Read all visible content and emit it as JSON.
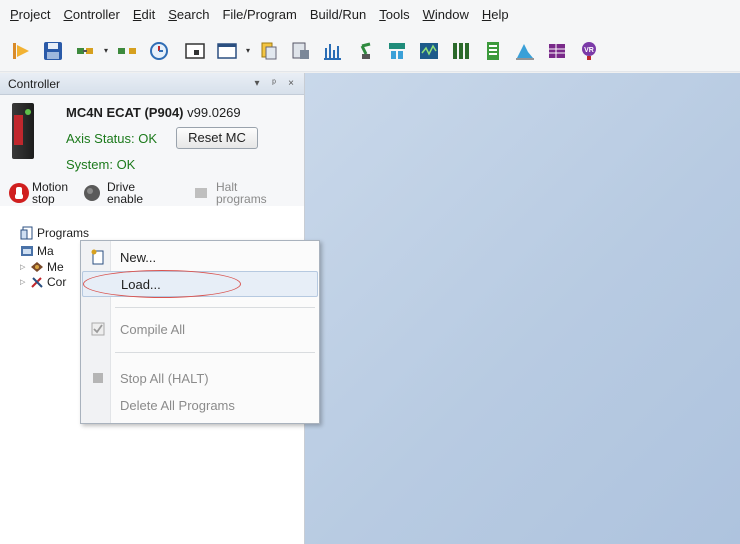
{
  "menubar": {
    "items": [
      {
        "label": "Project",
        "key": "P"
      },
      {
        "label": "Controller",
        "key": "C"
      },
      {
        "label": "Edit",
        "key": "E"
      },
      {
        "label": "Search",
        "key": "S"
      },
      {
        "label": "File/Program",
        "key": ""
      },
      {
        "label": "Build/Run",
        "key": ""
      },
      {
        "label": "Tools",
        "key": "T"
      },
      {
        "label": "Window",
        "key": "W"
      },
      {
        "label": "Help",
        "key": "H"
      }
    ]
  },
  "toolbar": {
    "icons": [
      "build-icon",
      "save-icon",
      "connect-icon",
      "disconnect-icon",
      "clock-icon",
      "terminal-icon",
      "window-icon",
      "program-icon",
      "variables-icon",
      "scope-icon",
      "robot-icon",
      "network-icon",
      "oscilloscope-icon",
      "io-icon",
      "table-icon",
      "graph-icon",
      "grid-icon",
      "vr-icon"
    ]
  },
  "panel": {
    "title": "Controller",
    "header_buttons": [
      "▾",
      "ᵖ",
      "×"
    ],
    "device_name": "MC4N ECAT (P904)",
    "device_version": "v99.0269",
    "axis_status": "Axis Status: OK",
    "reset_label": "Reset MC",
    "system_status": "System: OK",
    "motion_stop_line1": "Motion",
    "motion_stop_line2": "stop",
    "drive_enable_line1": "Drive",
    "drive_enable_line2": "enable",
    "halt_line1": "Halt",
    "halt_line2": "programs",
    "colors": {
      "status_ok": "#1c7a1c",
      "stop_red": "#d01f1f"
    }
  },
  "tree": {
    "items": [
      {
        "label": "Programs"
      },
      {
        "label": "Ma"
      },
      {
        "label": "Me"
      },
      {
        "label": "Cor"
      }
    ]
  },
  "context_menu": {
    "new_label": "New...",
    "load_label": "Load...",
    "compile_label": "Compile All",
    "stop_label": "Stop All (HALT)",
    "delete_label": "Delete All Programs"
  }
}
